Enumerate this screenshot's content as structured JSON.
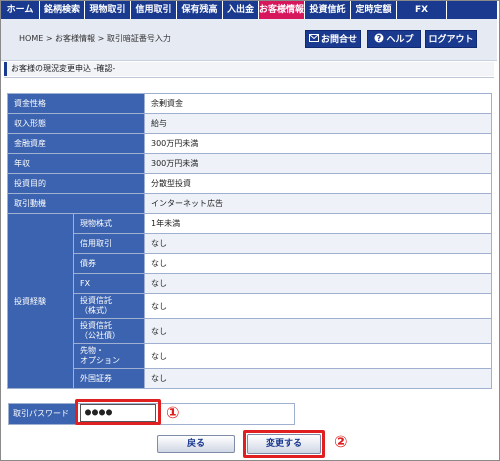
{
  "nav": {
    "items": [
      {
        "label": "ホーム",
        "active": false
      },
      {
        "label": "銘柄検索",
        "active": false
      },
      {
        "label": "現物取引",
        "active": false
      },
      {
        "label": "信用取引",
        "active": false
      },
      {
        "label": "保有残高",
        "active": false
      },
      {
        "label": "入出金",
        "active": false
      },
      {
        "label": "お客様情報",
        "active": true
      },
      {
        "label": "投資信託",
        "active": false
      },
      {
        "label": "定時定額",
        "active": false
      },
      {
        "label": "FX",
        "active": false
      }
    ]
  },
  "header": {
    "breadcrumb": "HOME > お客様情報 > 取引暗証番号入力",
    "contact_label": "お問合せ",
    "help_label": "ヘルプ",
    "logout_label": "ログアウト"
  },
  "section_title": "お客様の現況変更申込 -確認-",
  "table": {
    "rows": [
      {
        "label": "資金性格",
        "value": "余剰資金"
      },
      {
        "label": "収入形態",
        "value": "給与"
      },
      {
        "label": "金融資産",
        "value": "300万円未満"
      },
      {
        "label": "年収",
        "value": "300万円未満"
      },
      {
        "label": "投資目的",
        "value": "分散型投資"
      },
      {
        "label": "取引動機",
        "value": "インターネット広告"
      }
    ],
    "experience": {
      "label": "投資経験",
      "rows": [
        {
          "label": "現物株式",
          "value": "1年未満"
        },
        {
          "label": "信用取引",
          "value": "なし"
        },
        {
          "label": "債券",
          "value": "なし"
        },
        {
          "label": "FX",
          "value": "なし"
        },
        {
          "label": "投資信託\n（株式）",
          "value": "なし"
        },
        {
          "label": "投資信託\n（公社債）",
          "value": "なし"
        },
        {
          "label": "先物・\nオプション",
          "value": "なし"
        },
        {
          "label": "外国証券",
          "value": "なし"
        }
      ]
    }
  },
  "password": {
    "label": "取引パスワード",
    "value": "●●●●"
  },
  "buttons": {
    "back_label": "戻る",
    "submit_label": "変更する"
  },
  "annotations": {
    "step1": "①",
    "step2": "②"
  },
  "colors": {
    "nav_bg": "#1a3a8f",
    "nav_active": "#d6175c",
    "label_bg": "#3c63b0",
    "highlight": "#e02020"
  }
}
